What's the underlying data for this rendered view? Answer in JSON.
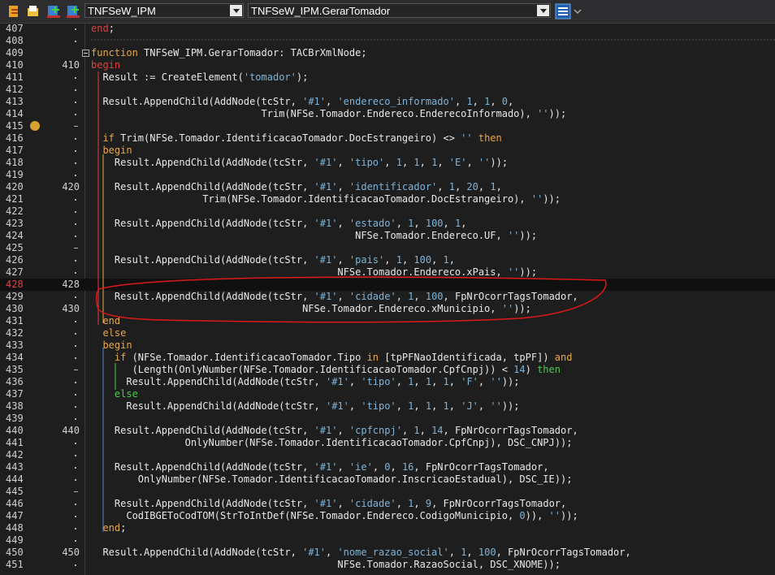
{
  "toolbar": {
    "unit_combo": "TNFSeW_IPM",
    "method_combo": "TNFSeW_IPM.GerarTomador"
  },
  "lines": [
    {
      "n": "407",
      "mark": "",
      "marker": "dot",
      "code": [
        {
          "t": "end",
          "c": "kwr"
        },
        {
          "t": ";"
        }
      ]
    },
    {
      "n": "408",
      "mark": "",
      "marker": "dot",
      "code": []
    },
    {
      "n": "409",
      "mark": "",
      "marker": "fold",
      "code": [
        {
          "t": "function",
          "c": "kw"
        },
        {
          "t": " TNFSeW_IPM.GerarTomador: TACBrXmlNode;"
        }
      ]
    },
    {
      "n": "410",
      "mark": "410",
      "marker": "",
      "code": [
        {
          "t": "begin",
          "c": "kwr"
        }
      ]
    },
    {
      "n": "411",
      "mark": "",
      "marker": "dot",
      "code": [
        {
          "t": "  Result := CreateElement("
        },
        {
          "t": "'tomador'",
          "c": "str"
        },
        {
          "t": ");"
        }
      ]
    },
    {
      "n": "412",
      "mark": "",
      "marker": "dot",
      "code": []
    },
    {
      "n": "413",
      "mark": "",
      "marker": "dot",
      "code": [
        {
          "t": "  Result.AppendChild(AddNode(tcStr, "
        },
        {
          "t": "'#1'",
          "c": "str"
        },
        {
          "t": ", "
        },
        {
          "t": "'endereco_informado'",
          "c": "str"
        },
        {
          "t": ", "
        },
        {
          "t": "1",
          "c": "num"
        },
        {
          "t": ", "
        },
        {
          "t": "1",
          "c": "num"
        },
        {
          "t": ", "
        },
        {
          "t": "0",
          "c": "num"
        },
        {
          "t": ","
        }
      ]
    },
    {
      "n": "414",
      "mark": "",
      "marker": "dot",
      "code": [
        {
          "t": "                             Trim(NFSe.Tomador.Endereco.EnderecoInformado), "
        },
        {
          "t": "''",
          "c": "str"
        },
        {
          "t": "));"
        }
      ]
    },
    {
      "n": "415",
      "mark": "",
      "marker": "dash",
      "code": []
    },
    {
      "n": "416",
      "mark": "",
      "marker": "dot",
      "code": [
        {
          "t": "  "
        },
        {
          "t": "if",
          "c": "kw"
        },
        {
          "t": " Trim(NFSe.Tomador.IdentificacaoTomador.DocEstrangeiro) <> "
        },
        {
          "t": "''",
          "c": "str"
        },
        {
          "t": " "
        },
        {
          "t": "then",
          "c": "kw"
        }
      ]
    },
    {
      "n": "417",
      "mark": "",
      "marker": "dot",
      "code": [
        {
          "t": "  "
        },
        {
          "t": "begin",
          "c": "kw"
        }
      ]
    },
    {
      "n": "418",
      "mark": "",
      "marker": "dot",
      "code": [
        {
          "t": "    Result.AppendChild(AddNode(tcStr, "
        },
        {
          "t": "'#1'",
          "c": "str"
        },
        {
          "t": ", "
        },
        {
          "t": "'tipo'",
          "c": "str"
        },
        {
          "t": ", "
        },
        {
          "t": "1",
          "c": "num"
        },
        {
          "t": ", "
        },
        {
          "t": "1",
          "c": "num"
        },
        {
          "t": ", "
        },
        {
          "t": "1",
          "c": "num"
        },
        {
          "t": ", "
        },
        {
          "t": "'E'",
          "c": "str"
        },
        {
          "t": ", "
        },
        {
          "t": "''",
          "c": "str"
        },
        {
          "t": "));"
        }
      ]
    },
    {
      "n": "419",
      "mark": "",
      "marker": "dot",
      "code": []
    },
    {
      "n": "420",
      "mark": "420",
      "marker": "",
      "code": [
        {
          "t": "    Result.AppendChild(AddNode(tcStr, "
        },
        {
          "t": "'#1'",
          "c": "str"
        },
        {
          "t": ", "
        },
        {
          "t": "'identificador'",
          "c": "str"
        },
        {
          "t": ", "
        },
        {
          "t": "1",
          "c": "num"
        },
        {
          "t": ", "
        },
        {
          "t": "20",
          "c": "num"
        },
        {
          "t": ", "
        },
        {
          "t": "1",
          "c": "num"
        },
        {
          "t": ","
        }
      ]
    },
    {
      "n": "421",
      "mark": "",
      "marker": "dot",
      "code": [
        {
          "t": "                   Trim(NFSe.Tomador.IdentificacaoTomador.DocEstrangeiro), "
        },
        {
          "t": "''",
          "c": "str"
        },
        {
          "t": "));"
        }
      ]
    },
    {
      "n": "422",
      "mark": "",
      "marker": "dot",
      "code": []
    },
    {
      "n": "423",
      "mark": "",
      "marker": "dot",
      "code": [
        {
          "t": "    Result.AppendChild(AddNode(tcStr, "
        },
        {
          "t": "'#1'",
          "c": "str"
        },
        {
          "t": ", "
        },
        {
          "t": "'estado'",
          "c": "str"
        },
        {
          "t": ", "
        },
        {
          "t": "1",
          "c": "num"
        },
        {
          "t": ", "
        },
        {
          "t": "100",
          "c": "num"
        },
        {
          "t": ", "
        },
        {
          "t": "1",
          "c": "num"
        },
        {
          "t": ","
        }
      ]
    },
    {
      "n": "424",
      "mark": "",
      "marker": "dot",
      "code": [
        {
          "t": "                                             NFSe.Tomador.Endereco.UF, "
        },
        {
          "t": "''",
          "c": "str"
        },
        {
          "t": "));"
        }
      ]
    },
    {
      "n": "425",
      "mark": "",
      "marker": "dash",
      "code": []
    },
    {
      "n": "426",
      "mark": "",
      "marker": "dot",
      "code": [
        {
          "t": "    Result.AppendChild(AddNode(tcStr, "
        },
        {
          "t": "'#1'",
          "c": "str"
        },
        {
          "t": ", "
        },
        {
          "t": "'pais'",
          "c": "str"
        },
        {
          "t": ", "
        },
        {
          "t": "1",
          "c": "num"
        },
        {
          "t": ", "
        },
        {
          "t": "100",
          "c": "num"
        },
        {
          "t": ", "
        },
        {
          "t": "1",
          "c": "num"
        },
        {
          "t": ","
        }
      ]
    },
    {
      "n": "427",
      "mark": "",
      "marker": "dot",
      "code": [
        {
          "t": "                                          NFSe.Tomador.Endereco.xPais, "
        },
        {
          "t": "''",
          "c": "str"
        },
        {
          "t": "));"
        }
      ]
    },
    {
      "n": "428",
      "mark": "428",
      "marker": "",
      "cur": true,
      "code": []
    },
    {
      "n": "429",
      "mark": "",
      "marker": "dot",
      "code": [
        {
          "t": "    Result.AppendChild(AddNode(tcStr, "
        },
        {
          "t": "'#1'",
          "c": "str"
        },
        {
          "t": ", "
        },
        {
          "t": "'cidade'",
          "c": "str"
        },
        {
          "t": ", "
        },
        {
          "t": "1",
          "c": "num"
        },
        {
          "t": ", "
        },
        {
          "t": "100",
          "c": "num"
        },
        {
          "t": ", FpNrOcorrTagsTomador,"
        }
      ]
    },
    {
      "n": "430",
      "mark": "430",
      "marker": "",
      "code": [
        {
          "t": "                                    NFSe.Tomador.Endereco.xMunicipio, "
        },
        {
          "t": "''",
          "c": "str"
        },
        {
          "t": "));"
        }
      ]
    },
    {
      "n": "431",
      "mark": "",
      "marker": "dot",
      "code": [
        {
          "t": "  "
        },
        {
          "t": "end",
          "c": "kw"
        }
      ]
    },
    {
      "n": "432",
      "mark": "",
      "marker": "dot",
      "code": [
        {
          "t": "  "
        },
        {
          "t": "else",
          "c": "kw"
        }
      ]
    },
    {
      "n": "433",
      "mark": "",
      "marker": "dot",
      "code": [
        {
          "t": "  "
        },
        {
          "t": "begin",
          "c": "kw"
        }
      ]
    },
    {
      "n": "434",
      "mark": "",
      "marker": "dot",
      "code": [
        {
          "t": "    "
        },
        {
          "t": "if",
          "c": "kw"
        },
        {
          "t": " (NFSe.Tomador.IdentificacaoTomador.Tipo "
        },
        {
          "t": "in",
          "c": "kw"
        },
        {
          "t": " [tpPFNaoIdentificada, tpPF]) "
        },
        {
          "t": "and",
          "c": "kw"
        }
      ]
    },
    {
      "n": "435",
      "mark": "",
      "marker": "dash",
      "code": [
        {
          "t": "       (Length(OnlyNumber(NFSe.Tomador.IdentificacaoTomador.CpfCnpj)) < "
        },
        {
          "t": "14",
          "c": "num"
        },
        {
          "t": ") "
        },
        {
          "t": "then",
          "c": "kwg"
        }
      ]
    },
    {
      "n": "436",
      "mark": "",
      "marker": "dot",
      "code": [
        {
          "t": "      Result.AppendChild(AddNode(tcStr, "
        },
        {
          "t": "'#1'",
          "c": "str"
        },
        {
          "t": ", "
        },
        {
          "t": "'tipo'",
          "c": "str"
        },
        {
          "t": ", "
        },
        {
          "t": "1",
          "c": "num"
        },
        {
          "t": ", "
        },
        {
          "t": "1",
          "c": "num"
        },
        {
          "t": ", "
        },
        {
          "t": "1",
          "c": "num"
        },
        {
          "t": ", "
        },
        {
          "t": "'F'",
          "c": "str"
        },
        {
          "t": ", "
        },
        {
          "t": "''",
          "c": "str"
        },
        {
          "t": "));"
        }
      ]
    },
    {
      "n": "437",
      "mark": "",
      "marker": "dot",
      "code": [
        {
          "t": "    "
        },
        {
          "t": "else",
          "c": "kwg"
        }
      ]
    },
    {
      "n": "438",
      "mark": "",
      "marker": "dot",
      "code": [
        {
          "t": "      Result.AppendChild(AddNode(tcStr, "
        },
        {
          "t": "'#1'",
          "c": "str"
        },
        {
          "t": ", "
        },
        {
          "t": "'tipo'",
          "c": "str"
        },
        {
          "t": ", "
        },
        {
          "t": "1",
          "c": "num"
        },
        {
          "t": ", "
        },
        {
          "t": "1",
          "c": "num"
        },
        {
          "t": ", "
        },
        {
          "t": "1",
          "c": "num"
        },
        {
          "t": ", "
        },
        {
          "t": "'J'",
          "c": "str"
        },
        {
          "t": ", "
        },
        {
          "t": "''",
          "c": "str"
        },
        {
          "t": "));"
        }
      ]
    },
    {
      "n": "439",
      "mark": "",
      "marker": "dot",
      "code": []
    },
    {
      "n": "440",
      "mark": "440",
      "marker": "",
      "code": [
        {
          "t": "    Result.AppendChild(AddNode(tcStr, "
        },
        {
          "t": "'#1'",
          "c": "str"
        },
        {
          "t": ", "
        },
        {
          "t": "'cpfcnpj'",
          "c": "str"
        },
        {
          "t": ", "
        },
        {
          "t": "1",
          "c": "num"
        },
        {
          "t": ", "
        },
        {
          "t": "14",
          "c": "num"
        },
        {
          "t": ", FpNrOcorrTagsTomador,"
        }
      ]
    },
    {
      "n": "441",
      "mark": "",
      "marker": "dot",
      "code": [
        {
          "t": "                OnlyNumber(NFSe.Tomador.IdentificacaoTomador.CpfCnpj), DSC_CNPJ));"
        }
      ]
    },
    {
      "n": "442",
      "mark": "",
      "marker": "dot",
      "code": []
    },
    {
      "n": "443",
      "mark": "",
      "marker": "dot",
      "code": [
        {
          "t": "    Result.AppendChild(AddNode(tcStr, "
        },
        {
          "t": "'#1'",
          "c": "str"
        },
        {
          "t": ", "
        },
        {
          "t": "'ie'",
          "c": "str"
        },
        {
          "t": ", "
        },
        {
          "t": "0",
          "c": "num"
        },
        {
          "t": ", "
        },
        {
          "t": "16",
          "c": "num"
        },
        {
          "t": ", FpNrOcorrTagsTomador,"
        }
      ]
    },
    {
      "n": "444",
      "mark": "",
      "marker": "dot",
      "code": [
        {
          "t": "        OnlyNumber(NFSe.Tomador.IdentificacaoTomador.InscricaoEstadual), DSC_IE));"
        }
      ]
    },
    {
      "n": "445",
      "mark": "",
      "marker": "dash",
      "code": []
    },
    {
      "n": "446",
      "mark": "",
      "marker": "dot",
      "code": [
        {
          "t": "    Result.AppendChild(AddNode(tcStr, "
        },
        {
          "t": "'#1'",
          "c": "str"
        },
        {
          "t": ", "
        },
        {
          "t": "'cidade'",
          "c": "str"
        },
        {
          "t": ", "
        },
        {
          "t": "1",
          "c": "num"
        },
        {
          "t": ", "
        },
        {
          "t": "9",
          "c": "num"
        },
        {
          "t": ", FpNrOcorrTagsTomador,"
        }
      ]
    },
    {
      "n": "447",
      "mark": "",
      "marker": "dot",
      "code": [
        {
          "t": "      CodIBGEToCodTOM(StrToIntDef(NFSe.Tomador.Endereco.CodigoMunicipio, "
        },
        {
          "t": "0",
          "c": "num"
        },
        {
          "t": ")), "
        },
        {
          "t": "''",
          "c": "str"
        },
        {
          "t": "));"
        }
      ]
    },
    {
      "n": "448",
      "mark": "",
      "marker": "dot",
      "code": [
        {
          "t": "  "
        },
        {
          "t": "end",
          "c": "kw"
        },
        {
          "t": ";"
        }
      ]
    },
    {
      "n": "449",
      "mark": "",
      "marker": "dot",
      "code": []
    },
    {
      "n": "450",
      "mark": "450",
      "marker": "",
      "code": [
        {
          "t": "  Result.AppendChild(AddNode(tcStr, "
        },
        {
          "t": "'#1'",
          "c": "str"
        },
        {
          "t": ", "
        },
        {
          "t": "'nome_razao_social'",
          "c": "str"
        },
        {
          "t": ", "
        },
        {
          "t": "1",
          "c": "num"
        },
        {
          "t": ", "
        },
        {
          "t": "100",
          "c": "num"
        },
        {
          "t": ", FpNrOcorrTagsTomador,"
        }
      ]
    },
    {
      "n": "451",
      "mark": "",
      "marker": "dot",
      "code": [
        {
          "t": "                                          NFSe.Tomador.RazaoSocial, DSC_XNOME));"
        }
      ]
    }
  ]
}
